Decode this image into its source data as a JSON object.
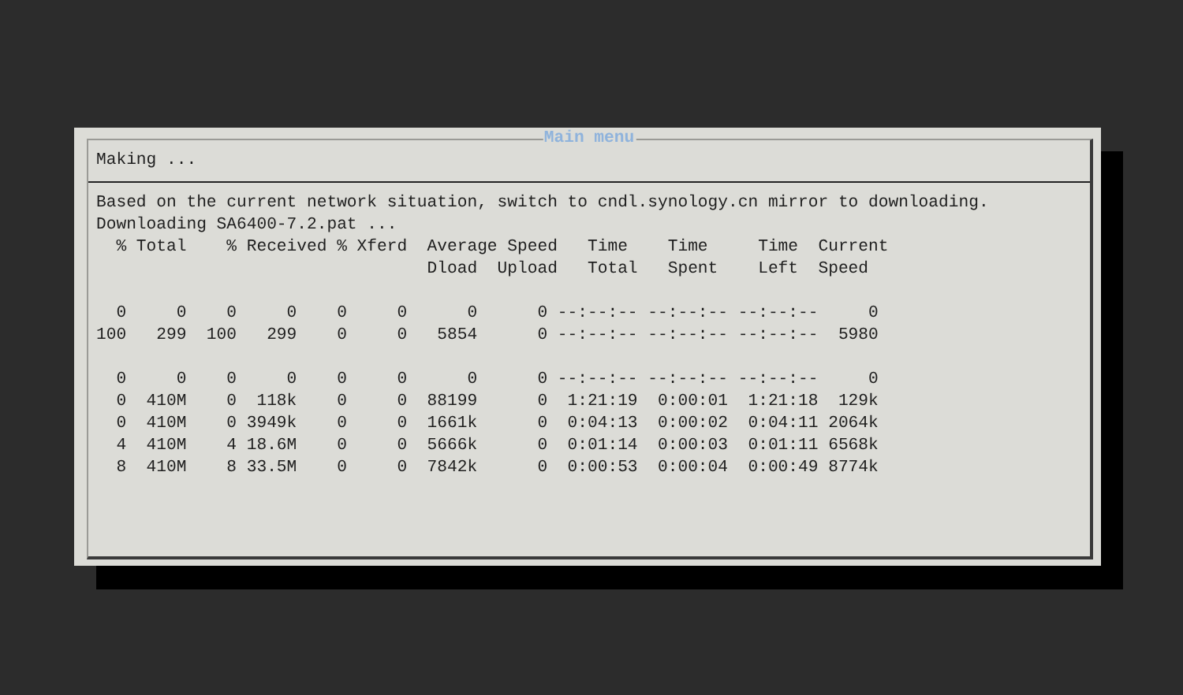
{
  "dialog": {
    "title": "Main menu",
    "heading": "Making ...",
    "blocks": [
      [
        "Based on the current network situation, switch to cndl.synology.cn mirror to downloading.",
        "Downloading SA6400-7.2.pat ...",
        "  % Total    % Received % Xferd  Average Speed   Time    Time     Time  Current",
        "                                 Dload  Upload   Total   Spent    Left  Speed"
      ],
      [
        "  0     0    0     0    0     0      0      0 --:--:-- --:--:-- --:--:--     0",
        "100   299  100   299    0     0   5854      0 --:--:-- --:--:-- --:--:--  5980"
      ],
      [
        "  0     0    0     0    0     0      0      0 --:--:-- --:--:-- --:--:--     0",
        "  0  410M    0  118k    0     0  88199      0  1:21:19  0:00:01  1:21:18  129k",
        "  0  410M    0 3949k    0     0  1661k      0  0:04:13  0:00:02  0:04:11 2064k",
        "  4  410M    4 18.6M    0     0  5666k      0  0:01:14  0:00:03  0:01:11 6568k",
        "  8  410M    8 33.5M    0     0  7842k      0  0:00:53  0:00:04  0:00:49 8774k"
      ]
    ]
  }
}
